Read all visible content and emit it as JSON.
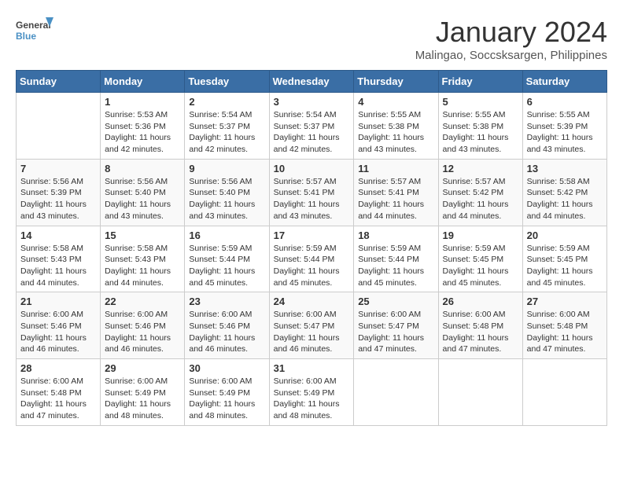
{
  "logo": {
    "line1": "General",
    "line2": "Blue"
  },
  "title": "January 2024",
  "subtitle": "Malingao, Soccsksargen, Philippines",
  "headers": [
    "Sunday",
    "Monday",
    "Tuesday",
    "Wednesday",
    "Thursday",
    "Friday",
    "Saturday"
  ],
  "weeks": [
    [
      {
        "day": "",
        "info": ""
      },
      {
        "day": "1",
        "info": "Sunrise: 5:53 AM\nSunset: 5:36 PM\nDaylight: 11 hours\nand 42 minutes."
      },
      {
        "day": "2",
        "info": "Sunrise: 5:54 AM\nSunset: 5:37 PM\nDaylight: 11 hours\nand 42 minutes."
      },
      {
        "day": "3",
        "info": "Sunrise: 5:54 AM\nSunset: 5:37 PM\nDaylight: 11 hours\nand 42 minutes."
      },
      {
        "day": "4",
        "info": "Sunrise: 5:55 AM\nSunset: 5:38 PM\nDaylight: 11 hours\nand 43 minutes."
      },
      {
        "day": "5",
        "info": "Sunrise: 5:55 AM\nSunset: 5:38 PM\nDaylight: 11 hours\nand 43 minutes."
      },
      {
        "day": "6",
        "info": "Sunrise: 5:55 AM\nSunset: 5:39 PM\nDaylight: 11 hours\nand 43 minutes."
      }
    ],
    [
      {
        "day": "7",
        "info": "Sunrise: 5:56 AM\nSunset: 5:39 PM\nDaylight: 11 hours\nand 43 minutes."
      },
      {
        "day": "8",
        "info": "Sunrise: 5:56 AM\nSunset: 5:40 PM\nDaylight: 11 hours\nand 43 minutes."
      },
      {
        "day": "9",
        "info": "Sunrise: 5:56 AM\nSunset: 5:40 PM\nDaylight: 11 hours\nand 43 minutes."
      },
      {
        "day": "10",
        "info": "Sunrise: 5:57 AM\nSunset: 5:41 PM\nDaylight: 11 hours\nand 43 minutes."
      },
      {
        "day": "11",
        "info": "Sunrise: 5:57 AM\nSunset: 5:41 PM\nDaylight: 11 hours\nand 44 minutes."
      },
      {
        "day": "12",
        "info": "Sunrise: 5:57 AM\nSunset: 5:42 PM\nDaylight: 11 hours\nand 44 minutes."
      },
      {
        "day": "13",
        "info": "Sunrise: 5:58 AM\nSunset: 5:42 PM\nDaylight: 11 hours\nand 44 minutes."
      }
    ],
    [
      {
        "day": "14",
        "info": "Sunrise: 5:58 AM\nSunset: 5:43 PM\nDaylight: 11 hours\nand 44 minutes."
      },
      {
        "day": "15",
        "info": "Sunrise: 5:58 AM\nSunset: 5:43 PM\nDaylight: 11 hours\nand 44 minutes."
      },
      {
        "day": "16",
        "info": "Sunrise: 5:59 AM\nSunset: 5:44 PM\nDaylight: 11 hours\nand 45 minutes."
      },
      {
        "day": "17",
        "info": "Sunrise: 5:59 AM\nSunset: 5:44 PM\nDaylight: 11 hours\nand 45 minutes."
      },
      {
        "day": "18",
        "info": "Sunrise: 5:59 AM\nSunset: 5:44 PM\nDaylight: 11 hours\nand 45 minutes."
      },
      {
        "day": "19",
        "info": "Sunrise: 5:59 AM\nSunset: 5:45 PM\nDaylight: 11 hours\nand 45 minutes."
      },
      {
        "day": "20",
        "info": "Sunrise: 5:59 AM\nSunset: 5:45 PM\nDaylight: 11 hours\nand 45 minutes."
      }
    ],
    [
      {
        "day": "21",
        "info": "Sunrise: 6:00 AM\nSunset: 5:46 PM\nDaylight: 11 hours\nand 46 minutes."
      },
      {
        "day": "22",
        "info": "Sunrise: 6:00 AM\nSunset: 5:46 PM\nDaylight: 11 hours\nand 46 minutes."
      },
      {
        "day": "23",
        "info": "Sunrise: 6:00 AM\nSunset: 5:46 PM\nDaylight: 11 hours\nand 46 minutes."
      },
      {
        "day": "24",
        "info": "Sunrise: 6:00 AM\nSunset: 5:47 PM\nDaylight: 11 hours\nand 46 minutes."
      },
      {
        "day": "25",
        "info": "Sunrise: 6:00 AM\nSunset: 5:47 PM\nDaylight: 11 hours\nand 47 minutes."
      },
      {
        "day": "26",
        "info": "Sunrise: 6:00 AM\nSunset: 5:48 PM\nDaylight: 11 hours\nand 47 minutes."
      },
      {
        "day": "27",
        "info": "Sunrise: 6:00 AM\nSunset: 5:48 PM\nDaylight: 11 hours\nand 47 minutes."
      }
    ],
    [
      {
        "day": "28",
        "info": "Sunrise: 6:00 AM\nSunset: 5:48 PM\nDaylight: 11 hours\nand 47 minutes."
      },
      {
        "day": "29",
        "info": "Sunrise: 6:00 AM\nSunset: 5:49 PM\nDaylight: 11 hours\nand 48 minutes."
      },
      {
        "day": "30",
        "info": "Sunrise: 6:00 AM\nSunset: 5:49 PM\nDaylight: 11 hours\nand 48 minutes."
      },
      {
        "day": "31",
        "info": "Sunrise: 6:00 AM\nSunset: 5:49 PM\nDaylight: 11 hours\nand 48 minutes."
      },
      {
        "day": "",
        "info": ""
      },
      {
        "day": "",
        "info": ""
      },
      {
        "day": "",
        "info": ""
      }
    ]
  ]
}
